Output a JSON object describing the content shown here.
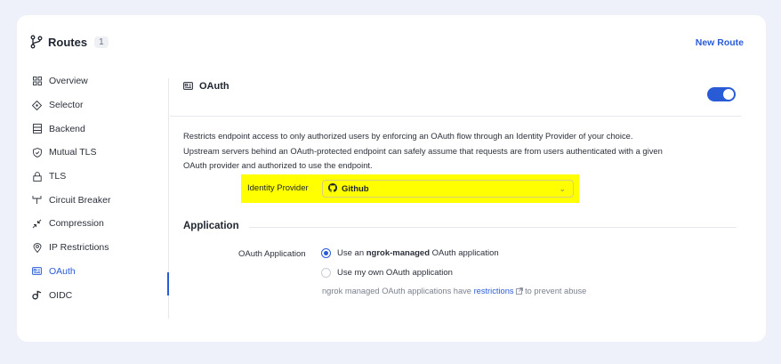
{
  "header": {
    "title": "Routes",
    "count": "1",
    "new_route_label": "New Route"
  },
  "sidebar": {
    "items": [
      {
        "label": "Overview",
        "icon": "grid-icon"
      },
      {
        "label": "Selector",
        "icon": "selector-icon"
      },
      {
        "label": "Backend",
        "icon": "backend-icon"
      },
      {
        "label": "Mutual TLS",
        "icon": "shield-icon"
      },
      {
        "label": "TLS",
        "icon": "lock-icon"
      },
      {
        "label": "Circuit Breaker",
        "icon": "circuit-breaker-icon"
      },
      {
        "label": "Compression",
        "icon": "compress-icon"
      },
      {
        "label": "IP Restrictions",
        "icon": "location-pin-icon"
      },
      {
        "label": "OAuth",
        "icon": "id-card-icon",
        "active": true
      },
      {
        "label": "OIDC",
        "icon": "oidc-icon"
      }
    ]
  },
  "oauth": {
    "title": "OAuth",
    "enabled": true,
    "description": "Restricts endpoint access to only authorized users by enforcing an OAuth flow through an Identity Provider of your choice. Upstream servers behind an OAuth-protected endpoint can safely assume that requests are from users authenticated with a given OAuth provider and authorized to use the endpoint.",
    "identity_provider_label": "Identity Provider",
    "identity_provider_value": "Github"
  },
  "application": {
    "title": "Application",
    "oauth_application_label": "OAuth Application",
    "option_managed_prefix": "Use an ",
    "option_managed_bold": "ngrok-managed",
    "option_managed_suffix": " OAuth application",
    "option_own": "Use my own OAuth application",
    "note_prefix": "ngrok managed OAuth applications have ",
    "note_link": "restrictions",
    "note_suffix": " to prevent abuse"
  },
  "colors": {
    "accent": "#2a5bd7",
    "highlight": "#ffff00"
  }
}
